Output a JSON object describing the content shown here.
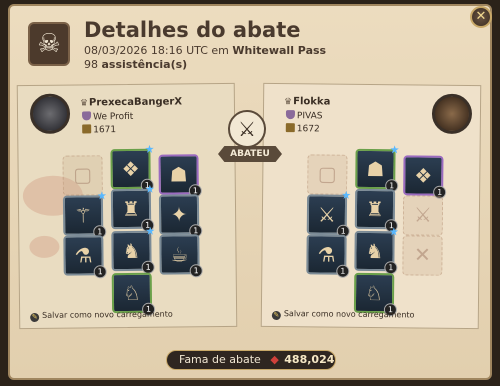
{
  "header": {
    "title": "Detalhes do abate",
    "timestamp": "08/03/2026 18:16 UTC em",
    "location": "Whitewall Pass",
    "assist_count": "98",
    "assist_word": "assistência(s)"
  },
  "center": {
    "verdict": "ABATEU"
  },
  "killer": {
    "name": "PrexecaBangerX",
    "guild": "We Profit",
    "ip": "1671",
    "save_label": "Salvar como novo carregamento",
    "slots": [
      {
        "icon": "empty-bag-icon",
        "glyph": "▢",
        "empty": true
      },
      {
        "icon": "cape-icon",
        "glyph": "❖",
        "level": "1",
        "star": true
      },
      {
        "icon": "hood-icon",
        "glyph": "☗",
        "level": "1"
      },
      {
        "icon": "fire-staff-icon",
        "glyph": "⚚",
        "level": "1",
        "star": true
      },
      {
        "icon": "robe-icon",
        "glyph": "♜",
        "level": "1",
        "star": true
      },
      {
        "icon": "offhand-tome-icon",
        "glyph": "✦",
        "level": "1"
      },
      {
        "icon": "potion-icon",
        "glyph": "⚗",
        "level": "1"
      },
      {
        "icon": "shoes-icon",
        "glyph": "♞",
        "level": "1",
        "star": true
      },
      {
        "icon": "food-icon",
        "glyph": "☕",
        "level": "1"
      },
      {
        "icon": "mount-icon",
        "glyph": "♘",
        "level": "1"
      }
    ]
  },
  "victim": {
    "name": "Flokka",
    "guild": "PIVAS",
    "ip": "1672",
    "save_label": "Salvar como novo carregamento",
    "slots": [
      {
        "icon": "empty-bag-icon",
        "glyph": "▢",
        "empty": true
      },
      {
        "icon": "helmet-icon",
        "glyph": "☗",
        "level": "1",
        "star": true
      },
      {
        "icon": "cape-icon",
        "glyph": "❖",
        "level": "1"
      },
      {
        "icon": "sword-icon",
        "glyph": "⚔",
        "level": "1",
        "star": true
      },
      {
        "icon": "plate-armor-icon",
        "glyph": "♜",
        "level": "1"
      },
      {
        "icon": "empty-offhand-icon",
        "glyph": "⚔",
        "empty": true
      },
      {
        "icon": "potion-icon",
        "glyph": "⚗",
        "level": "1"
      },
      {
        "icon": "boots-icon",
        "glyph": "♞",
        "level": "1",
        "star": true
      },
      {
        "icon": "empty-food-icon",
        "glyph": "✕",
        "empty": true
      },
      {
        "icon": "mount-icon",
        "glyph": "♘",
        "level": "1"
      }
    ]
  },
  "footer": {
    "fame_label": "Fama de abate",
    "fame_value": "488,024"
  },
  "colors": {
    "accent_blue": "#58b8ff",
    "fame_gem": "#d0403a",
    "panel": "#ecdcbf"
  }
}
